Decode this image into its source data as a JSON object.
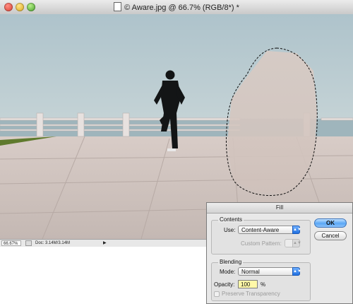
{
  "window": {
    "title": "© Aware.jpg @ 66.7% (RGB/8*) *"
  },
  "statusbar": {
    "zoom": "66.67%",
    "doc_info": "Doc: 3.14M/3.14M",
    "arrow": "▶"
  },
  "dialog": {
    "title": "Fill",
    "contents_group": "Contents",
    "use_label": "Use:",
    "use_value": "Content-Aware",
    "custom_pattern_label": "Custom Pattern:",
    "blending_group": "Blending",
    "mode_label": "Mode:",
    "mode_value": "Normal",
    "opacity_label": "Opacity:",
    "opacity_value": "100",
    "opacity_unit": "%",
    "preserve_label": "Preserve Transparency",
    "ok_label": "OK",
    "cancel_label": "Cancel"
  },
  "icons": {
    "window_close": "red-close-icon",
    "window_minimize": "yellow-minimize-icon",
    "window_zoom": "green-zoom-icon",
    "document": "document-icon",
    "dropdown": "chevron-updown-icon"
  }
}
